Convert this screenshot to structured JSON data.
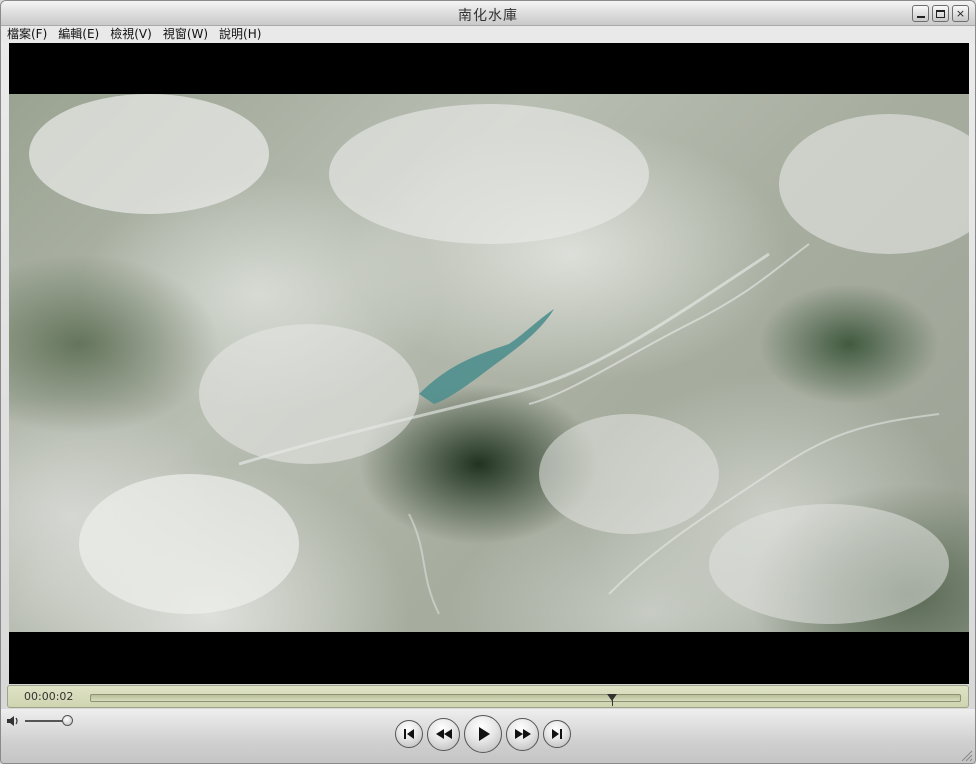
{
  "window": {
    "title": "南化水庫",
    "controls": [
      "minimize-icon",
      "maximize-icon",
      "close-icon"
    ],
    "close_glyph": "×"
  },
  "menu": [
    {
      "label": "檔案(F)"
    },
    {
      "label": "編輯(E)"
    },
    {
      "label": "檢視(V)"
    },
    {
      "label": "視窗(W)"
    },
    {
      "label": "說明(H)"
    }
  ],
  "video": {
    "content": "aerial satellite view with clouds over a reservoir"
  },
  "playback": {
    "current_time": "00:00:02",
    "position_fraction": 0.599
  },
  "volume": {
    "level_fraction": 1.0
  },
  "transport": [
    {
      "name": "previous-chapter-button",
      "icon": "skip-back-icon"
    },
    {
      "name": "rewind-button",
      "icon": "rewind-icon"
    },
    {
      "name": "play-button",
      "icon": "play-icon"
    },
    {
      "name": "fast-forward-button",
      "icon": "fast-forward-icon"
    },
    {
      "name": "next-chapter-button",
      "icon": "skip-forward-icon"
    }
  ],
  "colors": {
    "progress_bg": "#d6dbbb",
    "letterbox": "#000000"
  }
}
